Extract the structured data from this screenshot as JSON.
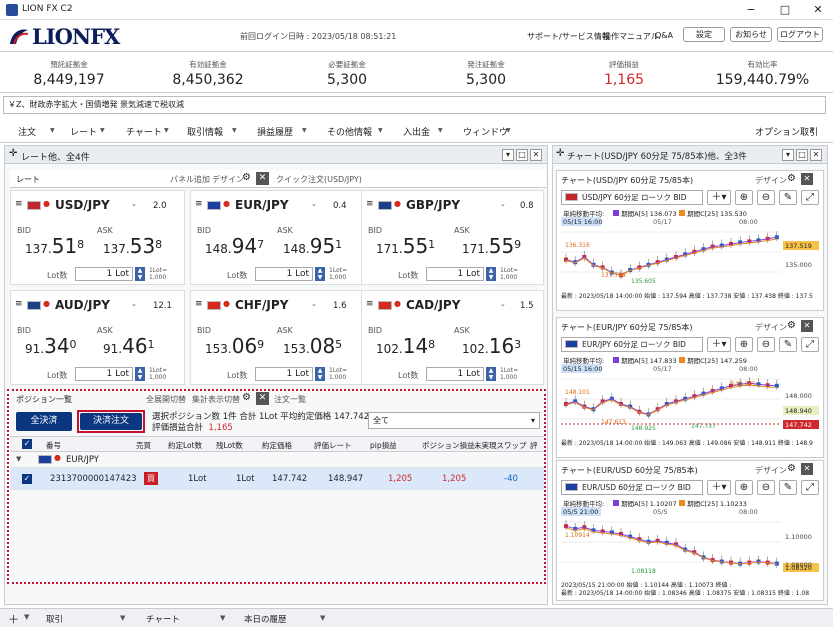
{
  "window": {
    "title": "LION FX C2",
    "min": "−",
    "max": "□",
    "close": "✕"
  },
  "brand": "LIONFX",
  "header": {
    "last_login": "前回ログイン日時 : 2023/05/18 08:51:21",
    "support": "サポート/サービス情報",
    "manual": "操作マニュアル",
    "qa": "Q&A",
    "settings": "設定",
    "notice": "お知らせ",
    "logout": "ログアウト"
  },
  "summary": [
    {
      "label": "預託証拠金",
      "value": "8,449,197"
    },
    {
      "label": "有効証拠金",
      "value": "8,450,362"
    },
    {
      "label": "必要証拠金",
      "value": "5,300"
    },
    {
      "label": "発注証拠金",
      "value": "5,300"
    },
    {
      "label": "評価損益",
      "value": "1,165"
    },
    {
      "label": "有効比率",
      "value": "159,440.79%"
    }
  ],
  "ticker": "￥Z、財政赤字拡大・国債増発 景気減速で税収減",
  "menu": [
    "注文",
    "レート",
    "チャート",
    "取引情報",
    "損益履歴",
    "その他情報",
    "入出金",
    "ウィンドウ"
  ],
  "menu_right": "オプション取引",
  "rate_panel": {
    "title": "レート他、全4件",
    "tab": "レート",
    "add": "パネル追加",
    "design": "デザイン",
    "search_placeholder": "クイック注文(USD/JPY)"
  },
  "rates": [
    {
      "pair": "USD/JPY",
      "spread": "2.0",
      "bid_label": "BID",
      "ask_label": "ASK",
      "bid_a": "137.",
      "bid_b": "51",
      "bid_c": "8",
      "ask_a": "137.",
      "ask_b": "53",
      "ask_c": "8",
      "lot_label": "Lot数",
      "lot": "1",
      "unit": "Lot",
      "lot_eq": "1Lot=\n1,000"
    },
    {
      "pair": "EUR/JPY",
      "spread": "0.4",
      "bid_label": "BID",
      "ask_label": "ASK",
      "bid_a": "148.",
      "bid_b": "94",
      "bid_c": "7",
      "ask_a": "148.",
      "ask_b": "95",
      "ask_c": "1",
      "lot_label": "Lot数",
      "lot": "1",
      "unit": "Lot",
      "lot_eq": "1Lot=\n1,000"
    },
    {
      "pair": "GBP/JPY",
      "spread": "0.8",
      "bid_label": "BID",
      "ask_label": "ASK",
      "bid_a": "171.",
      "bid_b": "55",
      "bid_c": "1",
      "ask_a": "171.",
      "ask_b": "55",
      "ask_c": "9",
      "lot_label": "Lot数",
      "lot": "1",
      "unit": "Lot",
      "lot_eq": "1Lot=\n1,000"
    },
    {
      "pair": "AUD/JPY",
      "spread": "12.1",
      "bid_label": "BID",
      "ask_label": "ASK",
      "bid_a": "91.",
      "bid_b": "34",
      "bid_c": "0",
      "ask_a": "91.",
      "ask_b": "46",
      "ask_c": "1",
      "lot_label": "Lot数",
      "lot": "1",
      "unit": "Lot",
      "lot_eq": "1Lot=\n1,000"
    },
    {
      "pair": "CHF/JPY",
      "spread": "1.6",
      "bid_label": "BID",
      "ask_label": "ASK",
      "bid_a": "153.",
      "bid_b": "06",
      "bid_c": "9",
      "ask_a": "153.",
      "ask_b": "08",
      "ask_c": "5",
      "lot_label": "Lot数",
      "lot": "1",
      "unit": "Lot",
      "lot_eq": "1Lot=\n1,000"
    },
    {
      "pair": "CAD/JPY",
      "spread": "1.5",
      "bid_label": "BID",
      "ask_label": "ASK",
      "bid_a": "102.",
      "bid_b": "14",
      "bid_c": "8",
      "ask_a": "102.",
      "ask_b": "16",
      "ask_c": "3",
      "lot_label": "Lot数",
      "lot": "1",
      "unit": "Lot",
      "lot_eq": "1Lot=\n1,000"
    }
  ],
  "positions": {
    "tab": "ポジション一覧",
    "toggle1": "全展開切替",
    "toggle2": "集計表示切替",
    "tab2": "注文一覧",
    "btn_all": "全決済",
    "btn_settle": "決済注文",
    "info1": "選択ポジション数 1件 合計 1Lot 平均約定価格 147.742",
    "info2_label": "評価損益合計",
    "info2_value": "1,165",
    "filter": "全て",
    "columns": [
      "番号",
      "売買",
      "約定Lot数",
      "残Lot数",
      "約定価格",
      "評価レート",
      "pip損益",
      "ポジション損益",
      "未実現スワップ",
      "評"
    ],
    "group": "EUR/JPY",
    "row": {
      "id": "2313700000147423",
      "side": "買",
      "lots": "1Lot",
      "remain": "1Lot",
      "price": "147.742",
      "rate": "148.947",
      "pip": "1,205",
      "pl": "1,205",
      "swap": "-40"
    }
  },
  "chart_panel": {
    "title": "チャート(USD/JPY 60分足 75/85本)他、全3件"
  },
  "charts": [
    {
      "title": "チャート(USD/JPY 60分足 75/85本)",
      "design": "デザイン",
      "sym": "USD/JPY 60分足 ローソク BID",
      "legend0": "単純移動平均:",
      "ma1": "期間A[5] 136.073",
      "ma2": "期間C[25] 135.530",
      "dates": [
        "05/15 16:00",
        "05/17",
        "08:00"
      ],
      "x_pre": "08:00",
      "labels": [
        "136.316",
        "135.605",
        "137.738"
      ],
      "price_now": "137.519",
      "axis": [
        "135.000"
      ],
      "footer1": "最新 : 2023/05/18 14:00:00 始値 : 137.594 高値 : 137.738 安値 : 137.438 終値 : 137.5"
    },
    {
      "title": "チャート(EUR/JPY 60分足 75/85本)",
      "design": "デザイン",
      "sym": "EUR/JPY 60分足 ローソク BID",
      "legend0": "単純移動平均:",
      "ma1": "期間A[5] 147.833",
      "ma2": "期間C[25] 147.259",
      "dates": [
        "05/15 16:00",
        "05/17",
        "08:00"
      ],
      "x_pre": "08:00",
      "labels": [
        "148.101",
        "148.925",
        "147.613",
        "147.737",
        "149.265"
      ],
      "price_now": "148.940",
      "price_pos": "147.742",
      "axis": [
        "148.000"
      ],
      "footer1": "最新 : 2023/05/18 14:00:00 始値 : 149.063 高値 : 149.086 安値 : 148.911 終値 : 148.9"
    },
    {
      "title": "チャート(EUR/USD 60分足 75/85本)",
      "design": "デザイン",
      "sym": "EUR/USD 60分足 ローソク BID",
      "legend0": "単純移動平均:",
      "ma1": "期間A[5] 1.10207",
      "ma2": "期間C[25] 1.10233",
      "dates": [
        "05/5 21:00",
        "05/5",
        "08:00"
      ],
      "x_pre": "08:00",
      "labels": [
        "1.10914",
        "1.08118"
      ],
      "price_now": "1.08320",
      "axis": [
        "1.10000",
        "1.08000"
      ],
      "footer0": "2023/05/15 21:00:00 始値 : 1.10144 高値 : 1.10073 終値 :",
      "footer1": "最新 : 2023/05/18 14:00:00 始値 : 1.08346 高値 : 1.08375 安値 : 1.08315 終値 : 1.08"
    }
  ],
  "statusbar": [
    "取引",
    "チャート",
    "本日の履歴"
  ],
  "flags": {
    "usd": "#c0282d",
    "eur": "#1c3fa0",
    "gbp": "#1c3f8a",
    "aud": "#1c3f8a",
    "chf": "#d52b1e",
    "cad": "#d52b1e"
  }
}
